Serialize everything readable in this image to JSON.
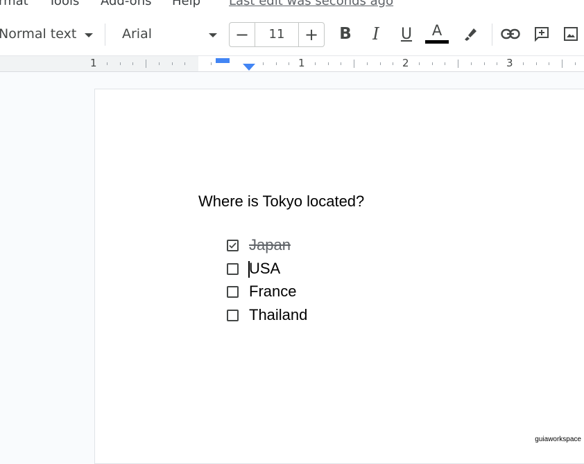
{
  "menubar": {
    "items": [
      "rmat",
      "Tools",
      "Add-ons",
      "Help"
    ],
    "last_edit": "Last edit was seconds ago"
  },
  "toolbar": {
    "style_select": "Normal text",
    "font_select": "Arial",
    "font_size": "11",
    "decrease_symbol": "−",
    "increase_symbol": "+",
    "bold": "B",
    "italic": "I",
    "underline": "U",
    "text_color_letter": "A",
    "text_color": "#000000"
  },
  "ruler": {
    "numbers": [
      "1",
      "1",
      "2",
      "3"
    ]
  },
  "document": {
    "question": "Where is Tokyo located?",
    "checklist": [
      {
        "label": "Japan",
        "checked": true
      },
      {
        "label": "USA",
        "checked": false
      },
      {
        "label": "France",
        "checked": false
      },
      {
        "label": "Thailand",
        "checked": false
      }
    ]
  },
  "watermark": "guiaworkspace",
  "colors": {
    "ruler_marker": "#4285f4",
    "toolbar_icon": "#444746"
  }
}
